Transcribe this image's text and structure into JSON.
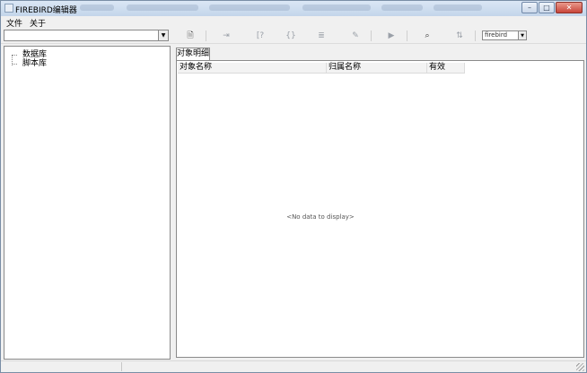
{
  "window": {
    "title": "FIREBIRD编辑器",
    "controls": {
      "minimize": "–",
      "maximize": "□",
      "close": "✕"
    }
  },
  "menu": {
    "items": [
      {
        "label": "文件"
      },
      {
        "label": "关于"
      }
    ]
  },
  "toolbar": {
    "connection_combo": {
      "value": ""
    },
    "database_type_combo": {
      "value": "firebird"
    },
    "icons": [
      {
        "name": "new-document-icon",
        "glyph": "🗎"
      },
      {
        "name": "indent-icon",
        "glyph": "⇥"
      },
      {
        "name": "bracket-icon",
        "glyph": "[?"
      },
      {
        "name": "brace-icon",
        "glyph": "{}"
      },
      {
        "name": "align-icon",
        "glyph": "≣"
      },
      {
        "name": "edit-doc-icon",
        "glyph": "✎"
      },
      {
        "name": "run-icon",
        "glyph": "▶"
      },
      {
        "name": "binoculars-icon",
        "glyph": "⌕"
      },
      {
        "name": "format-icon",
        "glyph": "⇅"
      }
    ]
  },
  "tree": {
    "nodes": [
      {
        "label": "数据库"
      },
      {
        "label": "脚本库"
      }
    ]
  },
  "detail": {
    "tab_label": "对象明细",
    "columns": [
      {
        "label": "对象名称"
      },
      {
        "label": "归属名称"
      },
      {
        "label": "有效"
      }
    ],
    "empty_text": "<No data to display>"
  },
  "colors": {
    "title_gradient_top": "#dbe7f5",
    "title_gradient_bottom": "#c3d5ea",
    "close_button": "#c8453a",
    "panel_border": "#8a8a8a",
    "window_background": "#f0f0f0"
  }
}
